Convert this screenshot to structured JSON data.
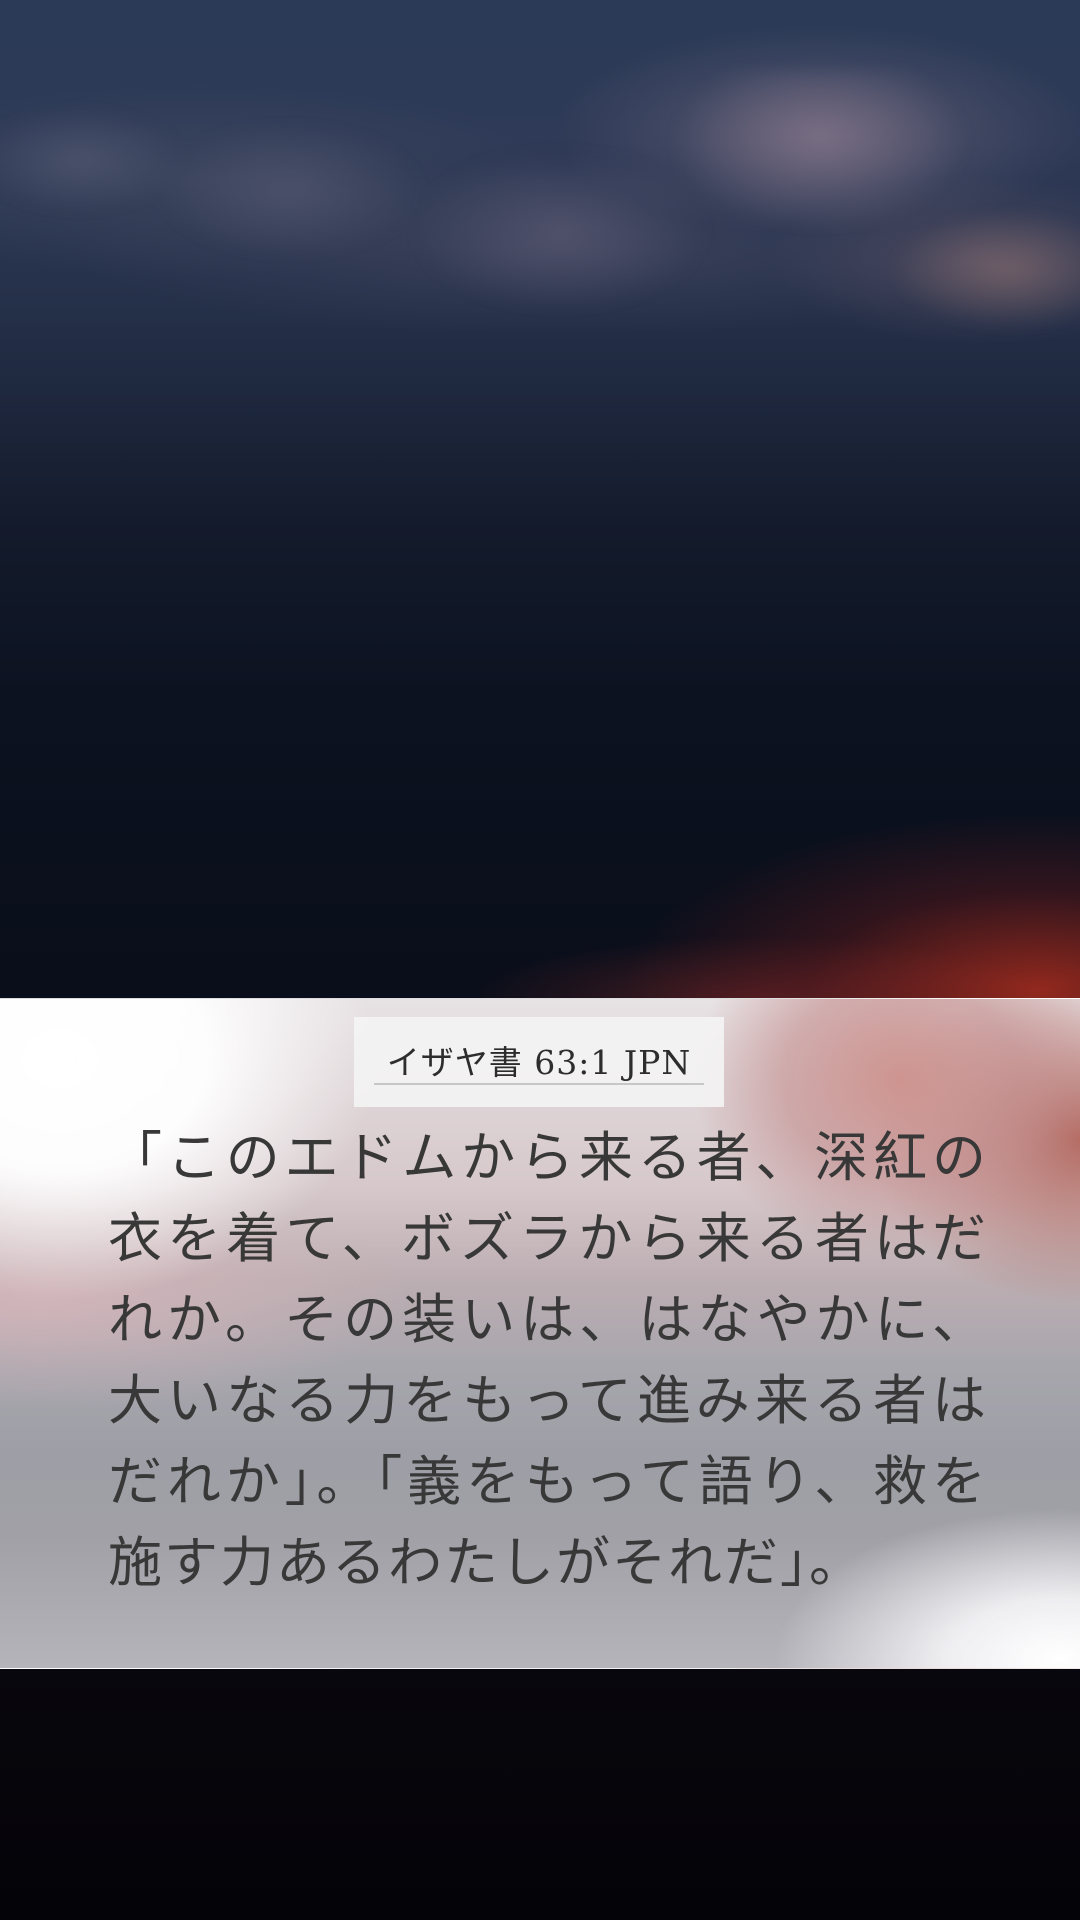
{
  "background": {
    "sky_top_color": "#2a3a57",
    "sky_bottom_color": "#0a0e1a",
    "accent_red": "#aa2d1e",
    "bottom_color": "#05040a"
  },
  "verse_card": {
    "reference": "イザヤ書 63:1 JPN",
    "text": "「このエドムから来る者、深紅の衣を着て、ボズラから来る者はだれか。その装いは、はなやかに、大いなる力をもって進み来る者はだれか」。「義をもって語り、救を施す力あるわたしがそれだ」。"
  }
}
